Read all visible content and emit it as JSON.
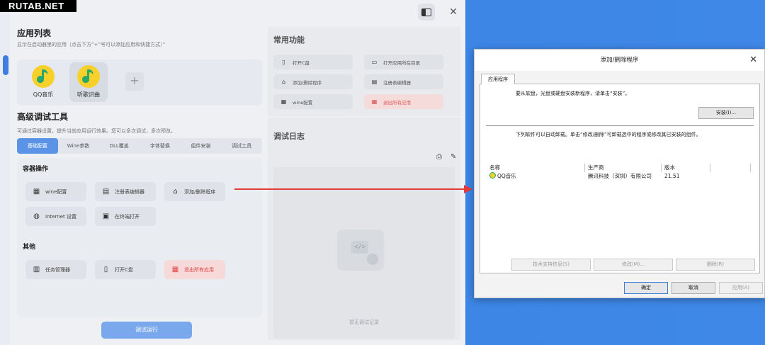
{
  "watermark": "RUTAB.NET",
  "app": {
    "app_list": {
      "title": "应用列表",
      "subtitle": "显示在启动器里的应用（点击下方“+”号可以添加应用和快捷方式）”",
      "items": [
        {
          "label": "QQ音乐"
        },
        {
          "label": "听歌识曲"
        }
      ],
      "add_label": "+"
    },
    "advanced": {
      "title": "高级调试工具",
      "subtitle": "可通过容器设置，提升当前应用运行效果。您可以多次调试，多次预览。",
      "tabs": [
        "基础配置",
        "Wine参数",
        "DLL覆盖",
        "字体替换",
        "组件安装",
        "调试工具"
      ],
      "container_ops_title": "容器操作",
      "container_ops": [
        {
          "label": "wine配置",
          "icon": "wine-icon"
        },
        {
          "label": "注册表编辑器",
          "icon": "registry-icon"
        },
        {
          "label": "添加/删除程序",
          "icon": "basket-icon"
        },
        {
          "label": "Internet 设置",
          "icon": "globe-icon"
        },
        {
          "label": "在终端打开",
          "icon": "terminal-icon"
        }
      ],
      "other_title": "其他",
      "other_ops": [
        {
          "label": "任务管理器",
          "icon": "taskmgr-icon"
        },
        {
          "label": "打开C盘",
          "icon": "drive-icon"
        },
        {
          "label": "退出所有应用",
          "icon": "exit-icon"
        }
      ],
      "run_label": "调试运行"
    },
    "common": {
      "title": "常用功能",
      "buttons": [
        {
          "label": "打开C盘"
        },
        {
          "label": "打开应用所在目录"
        },
        {
          "label": "添加/删除程序"
        },
        {
          "label": "注册表编辑器"
        },
        {
          "label": "wine配置"
        },
        {
          "label": "退出所有应用"
        }
      ]
    },
    "log": {
      "title": "调试日志",
      "empty_text": "暂无调试记录"
    }
  },
  "dialog": {
    "title": "添加/删除程序",
    "tab": "应用程序",
    "install_text": "要从软盘，光盘或硬盘安装新程序，请单击“安装”。",
    "install_button": "安装(I)...",
    "uninstall_text": "下列软件可以自动卸载。单击“修改/删除”可卸载选中的程序或修改其已安装的组件。",
    "columns": [
      "名称",
      "生产商",
      "版本"
    ],
    "rows": [
      {
        "name": "QQ音乐",
        "vendor": "腾讯科技（深圳）有限公司",
        "version": "21.51"
      }
    ],
    "support_button": "技术支持信息(S)",
    "modify_button": "修改(M)...",
    "remove_button": "删除(R)",
    "ok_button": "确定",
    "cancel_button": "取消",
    "apply_button": "应用(A)"
  },
  "colors": {
    "accent": "#5b94e6",
    "danger": "#e53a3a",
    "desktop": "#3d86e6"
  }
}
